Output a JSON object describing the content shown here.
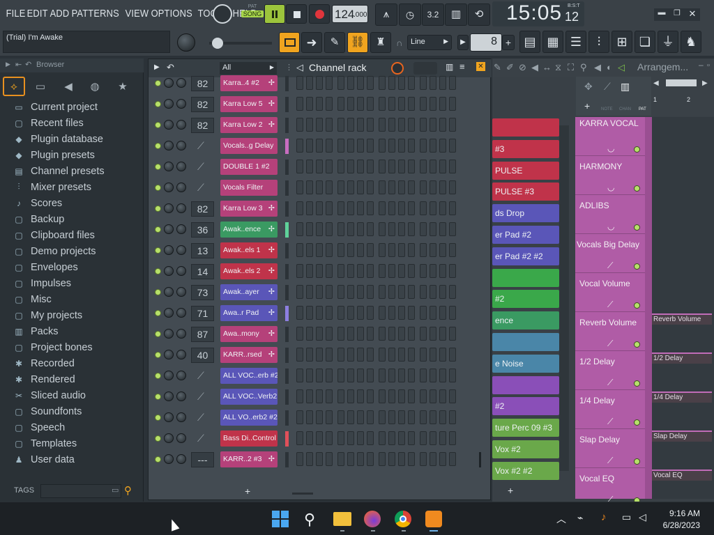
{
  "menus": [
    "FILE",
    "EDIT",
    "ADD",
    "PATTERNS",
    "VIEW",
    "OPTIONS",
    "TOOLS",
    "HELP"
  ],
  "transport": {
    "pat_label": "PAT",
    "song_label": "SONG",
    "tempo": "124",
    "tempo_decimal": ".000"
  },
  "clock": {
    "time": "15:05",
    "seconds": "12",
    "format": "B:S:T"
  },
  "song_title": "(Trial) I'm Awake",
  "snap": "Line",
  "step_value": "8",
  "browser": {
    "title": "Browser",
    "items": [
      {
        "label": "Current project",
        "icon": "project-icon"
      },
      {
        "label": "Recent files",
        "icon": "recent-folder-icon"
      },
      {
        "label": "Plugin database",
        "icon": "plugin-icon"
      },
      {
        "label": "Plugin presets",
        "icon": "plugin-preset-icon"
      },
      {
        "label": "Channel presets",
        "icon": "channel-preset-icon"
      },
      {
        "label": "Mixer presets",
        "icon": "mixer-preset-icon"
      },
      {
        "label": "Scores",
        "icon": "score-icon"
      },
      {
        "label": "Backup",
        "icon": "backup-folder-icon"
      },
      {
        "label": "Clipboard files",
        "icon": "folder-icon"
      },
      {
        "label": "Demo projects",
        "icon": "folder-icon"
      },
      {
        "label": "Envelopes",
        "icon": "folder-icon"
      },
      {
        "label": "Impulses",
        "icon": "folder-icon"
      },
      {
        "label": "Misc",
        "icon": "folder-icon"
      },
      {
        "label": "My projects",
        "icon": "folder-icon"
      },
      {
        "label": "Packs",
        "icon": "packs-icon"
      },
      {
        "label": "Project bones",
        "icon": "folder-icon"
      },
      {
        "label": "Recorded",
        "icon": "recorded-icon"
      },
      {
        "label": "Rendered",
        "icon": "rendered-icon"
      },
      {
        "label": "Sliced audio",
        "icon": "sliced-icon"
      },
      {
        "label": "Soundfonts",
        "icon": "folder-icon"
      },
      {
        "label": "Speech",
        "icon": "folder-icon"
      },
      {
        "label": "Templates",
        "icon": "folder-icon"
      },
      {
        "label": "User data",
        "icon": "user-icon"
      }
    ],
    "tags_label": "TAGS"
  },
  "channel_rack": {
    "title": "Channel rack",
    "filter": "All",
    "channels": [
      {
        "mixer": "82",
        "name": "Karra..4 #2",
        "color": "#b5417a",
        "wave": true,
        "sel": ""
      },
      {
        "mixer": "82",
        "name": "Karra Low 5",
        "color": "#b5417a",
        "wave": true,
        "sel": ""
      },
      {
        "mixer": "82",
        "name": "Karra Low 2",
        "color": "#b5417a",
        "wave": true,
        "sel": ""
      },
      {
        "mixer": "",
        "name": "Vocals..g Delay",
        "color": "#b5417a",
        "wave": false,
        "sel": "#c86dc0"
      },
      {
        "mixer": "",
        "name": "DOUBLE 1 #2",
        "color": "#b5417a",
        "wave": false,
        "sel": ""
      },
      {
        "mixer": "",
        "name": "Vocals Filter",
        "color": "#b5417a",
        "wave": false,
        "sel": ""
      },
      {
        "mixer": "82",
        "name": "Karra Low 3",
        "color": "#b5417a",
        "wave": true,
        "sel": ""
      },
      {
        "mixer": "36",
        "name": "Awak..ence",
        "color": "#3a9a62",
        "wave": true,
        "sel": "#5fd29a"
      },
      {
        "mixer": "13",
        "name": "Awak..els 1",
        "color": "#c0334a",
        "wave": true,
        "sel": ""
      },
      {
        "mixer": "14",
        "name": "Awak..els 2",
        "color": "#c0334a",
        "wave": true,
        "sel": ""
      },
      {
        "mixer": "73",
        "name": "Awak..ayer",
        "color": "#5a56b8",
        "wave": true,
        "sel": ""
      },
      {
        "mixer": "71",
        "name": "Awa..r Pad",
        "color": "#5a56b8",
        "wave": true,
        "sel": "#8d7fe0"
      },
      {
        "mixer": "87",
        "name": "Awa..mony",
        "color": "#b5417a",
        "wave": true,
        "sel": ""
      },
      {
        "mixer": "40",
        "name": "KARR..rsed",
        "color": "#b5417a",
        "wave": true,
        "sel": ""
      },
      {
        "mixer": "",
        "name": "ALL VOC..erb #2",
        "color": "#5a56b8",
        "wave": false,
        "sel": ""
      },
      {
        "mixer": "",
        "name": "ALL VOC..Verb2",
        "color": "#5a56b8",
        "wave": false,
        "sel": ""
      },
      {
        "mixer": "",
        "name": "ALL VO..erb2 #2",
        "color": "#5a56b8",
        "wave": false,
        "sel": ""
      },
      {
        "mixer": "",
        "name": "Bass Di..Control",
        "color": "#c0334a",
        "wave": false,
        "sel": "#e0505a"
      },
      {
        "mixer": "---",
        "name": "KARR..2 #3",
        "color": "#b5417a",
        "wave": true,
        "sel": ""
      }
    ]
  },
  "playlist": {
    "title": "Arrangem...",
    "bars": [
      "1",
      "2"
    ],
    "clips": [
      {
        "label": "",
        "color": "#c0334a"
      },
      {
        "label": "#3",
        "color": "#c0334a"
      },
      {
        "label": "PULSE",
        "color": "#c0334a"
      },
      {
        "label": "PULSE #3",
        "color": "#c0334a"
      },
      {
        "label": "ds  Drop",
        "color": "#5a56b8"
      },
      {
        "label": "er Pad #2",
        "color": "#5a56b8"
      },
      {
        "label": "er Pad #2 #2",
        "color": "#5a56b8"
      },
      {
        "label": "",
        "color": "#3aa84a"
      },
      {
        "label": "#2",
        "color": "#3aa84a"
      },
      {
        "label": "ence",
        "color": "#3a9a62"
      },
      {
        "label": "",
        "color": "#4a86a8"
      },
      {
        "label": "e Noise",
        "color": "#4a86a8"
      },
      {
        "label": "",
        "color": "#8a4fb8"
      },
      {
        "label": "#2",
        "color": "#8a4fb8"
      },
      {
        "label": "ture Perc 09 #3",
        "color": "#6aa84a"
      },
      {
        "label": "Vox #2",
        "color": "#6aa84a"
      },
      {
        "label": "Vox #2 #2",
        "color": "#6aa84a"
      }
    ],
    "tracks": [
      "KARRA VOCAL",
      "HARMONY",
      "ADLIBS",
      "Vocals Big Delay",
      "Vocal Volume",
      "Reverb Volume",
      "1/2 Delay",
      "1/4 Delay",
      "Slap Delay",
      "Vocal EQ"
    ],
    "auto_clips": [
      "Reverb Volume",
      "1/2 Delay",
      "1/4 Delay",
      "Slap Delay",
      "Vocal EQ"
    ]
  },
  "taskbar": {
    "time": "9:16 AM",
    "date": "6/28/2023"
  }
}
